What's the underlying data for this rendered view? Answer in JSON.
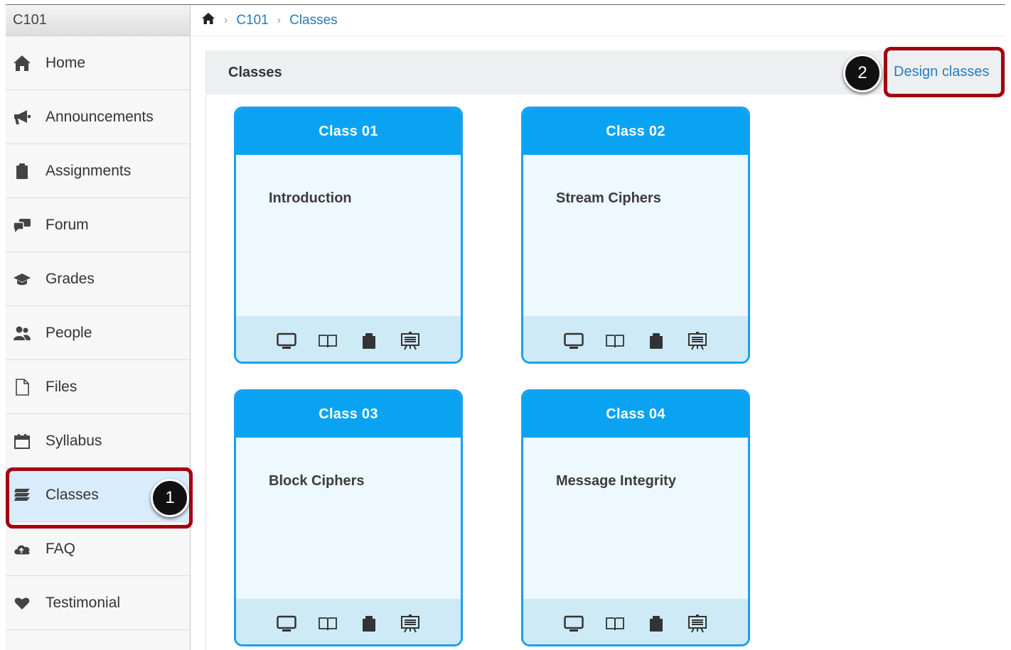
{
  "course": {
    "code": "C101"
  },
  "sidebar": {
    "items": [
      {
        "label": "Home",
        "icon": "home-icon"
      },
      {
        "label": "Announcements",
        "icon": "megaphone-icon"
      },
      {
        "label": "Assignments",
        "icon": "clipboard-icon"
      },
      {
        "label": "Forum",
        "icon": "comments-icon"
      },
      {
        "label": "Grades",
        "icon": "graduation-cap-icon"
      },
      {
        "label": "People",
        "icon": "users-icon"
      },
      {
        "label": "Files",
        "icon": "file-icon"
      },
      {
        "label": "Syllabus",
        "icon": "calendar-icon"
      },
      {
        "label": "Classes",
        "icon": "stack-icon",
        "active": true
      },
      {
        "label": "FAQ",
        "icon": "cloud-icon"
      },
      {
        "label": "Testimonial",
        "icon": "heart-icon"
      }
    ]
  },
  "breadcrumb": {
    "home_icon": "home-icon",
    "items": [
      "C101",
      "Classes"
    ]
  },
  "panel": {
    "title": "Classes",
    "design_link": "Design classes"
  },
  "steps": [
    "1",
    "2"
  ],
  "cards": [
    {
      "title": "Class  01",
      "subtitle": "Introduction"
    },
    {
      "title": "Class  02",
      "subtitle": "Stream Ciphers"
    },
    {
      "title": "Class  03",
      "subtitle": "Block Ciphers"
    },
    {
      "title": "Class  04",
      "subtitle": "Message Integrity"
    }
  ],
  "card_footer_icons": [
    "monitor-icon",
    "book-icon",
    "clipboard-icon",
    "presentation-icon"
  ],
  "colors": {
    "accent": "#0aa3f2",
    "highlight": "#a3000f",
    "link": "#2a7bbd",
    "active_bg": "#d9ecfb"
  }
}
